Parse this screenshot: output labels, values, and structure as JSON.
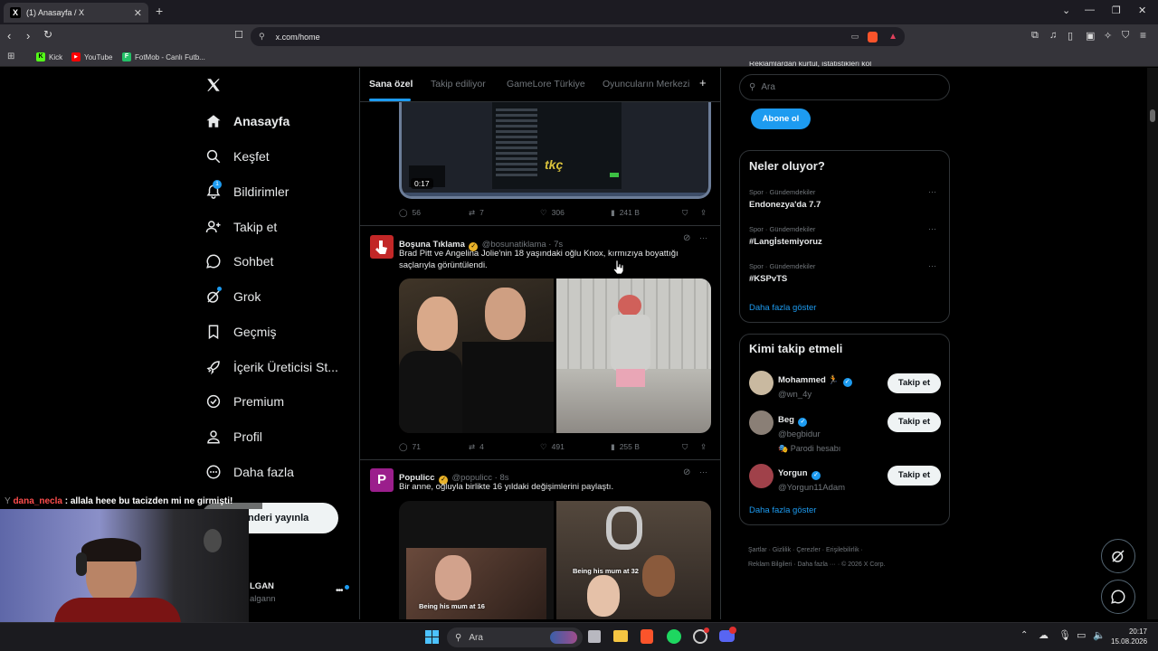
{
  "browser": {
    "tab_title": "(1) Anasayfa / X",
    "tab_icon_letter": "X",
    "new_tab": "+",
    "url": "x.com/home",
    "bookmarks": [
      {
        "label": "Kick",
        "color": "#53fc18",
        "letter": "K"
      },
      {
        "label": "YouTube",
        "color": "#ff0000",
        "letter": "▶"
      },
      {
        "label": "FotMob - Canlı Futb...",
        "color": "#23c167",
        "letter": "F"
      }
    ]
  },
  "nav": {
    "items": [
      {
        "label": "Anasayfa",
        "icon": "home-icon"
      },
      {
        "label": "Keşfet",
        "icon": "search-icon"
      },
      {
        "label": "Bildirimler",
        "icon": "bell-icon",
        "badge": "1"
      },
      {
        "label": "Takip et",
        "icon": "add-user-icon"
      },
      {
        "label": "Sohbet",
        "icon": "chat-icon"
      },
      {
        "label": "Grok",
        "icon": "grok-icon"
      },
      {
        "label": "Geçmiş",
        "icon": "bookmark-icon"
      },
      {
        "label": "İçerik Üreticisi St...",
        "icon": "rocket-icon"
      },
      {
        "label": "Premium",
        "icon": "verified-icon"
      },
      {
        "label": "Profil",
        "icon": "person-icon"
      },
      {
        "label": "Daha fazla",
        "icon": "more-circle-icon"
      }
    ],
    "post_button": "nderi yayınla",
    "account_name": "LGAN",
    "account_handle": "algann"
  },
  "overlay": {
    "chat_user": "dana_necla",
    "chat_message": ": allala heee bu tacizden mi ne girmişti!"
  },
  "feed": {
    "tabs": [
      "Sana özel",
      "Takip ediliyor",
      "GameLore Türkiye",
      "Oyuncuların Merkezi"
    ],
    "add_tab": "+",
    "video_duration": "0:17",
    "video_overlay_text": "tkç",
    "tweet0_stats": {
      "replies": "56",
      "retweets": "7",
      "likes": "306",
      "views": "241 B"
    },
    "tweets": [
      {
        "name": "Boşuna Tıklama",
        "handle": "@bosunatiklama · 7s",
        "text": "Brad Pitt ve Angelina Jolie'nin 18 yaşındaki oğlu Knox, kırmızıya boyattığı saçlarıyla görüntülendi.",
        "stats": {
          "replies": "71",
          "retweets": "4",
          "likes": "491",
          "views": "255 B"
        }
      },
      {
        "name": "Populicc",
        "handle": "@populicc · 8s",
        "text": "Bir anne, oğluyla birlikte 16 yıldaki değişimlerini paylaştı.",
        "image_captions": [
          "Being his mum at 16",
          "Being his mum at 32"
        ]
      }
    ]
  },
  "right": {
    "cut_text": "Reklamlardan kurtul, istatistikleri kol",
    "search_placeholder": "Ara",
    "subscribe": "Abone ol",
    "trends_title": "Neler oluyor?",
    "trends": [
      {
        "meta": "Spor · Gündemdekiler",
        "name": "Endonezya'da 7.7"
      },
      {
        "meta": "Spor · Gündemdekiler",
        "name": "#Langİstemiyoruz"
      },
      {
        "meta": "Spor · Gündemdekiler",
        "name": "#KSPvTS"
      }
    ],
    "trends_more": "Daha fazla göster",
    "who_title": "Kimi takip etmeli",
    "who": [
      {
        "name": "Mohammed 🏃",
        "handle": "@wn_4y",
        "avatar_color": "#c9b9a0",
        "follow": "Takip et"
      },
      {
        "name": "Beg",
        "handle": "@begbidur",
        "note": "🎭 Parodi hesabı",
        "avatar_color": "#8a7f76",
        "follow": "Takip et"
      },
      {
        "name": "Yorgun",
        "handle": "@Yorgun11Adam",
        "avatar_color": "#a0414a",
        "follow": "Takip et"
      }
    ],
    "who_more": "Daha fazla göster",
    "footer_line1": [
      "Şartlar",
      "Gizlilik",
      "Çerezler",
      "Erişilebilirlik"
    ],
    "footer_line2": [
      "Reklam Bilgileri",
      "Daha fazla ···",
      "© 2026 X Corp."
    ]
  },
  "taskbar": {
    "search_placeholder": "Ara",
    "time": "20:17",
    "date": "15.08.2026"
  }
}
